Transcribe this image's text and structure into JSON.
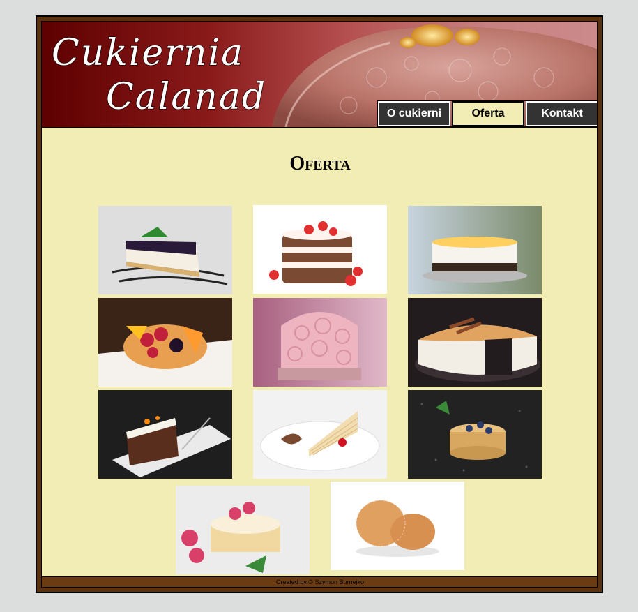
{
  "brand": {
    "line1": "Cukiernia",
    "line2": "Calanad"
  },
  "nav": [
    {
      "label": "O cukierni",
      "active": false
    },
    {
      "label": "Oferta",
      "active": true
    },
    {
      "label": "Kontakt",
      "active": false
    }
  ],
  "page_title": "Oferta",
  "gallery": [
    "blueberry-cheesecake-slice-photo",
    "strawberry-layer-cake-photo",
    "fruit-topped-cheesecake-photo",
    "fruit-tart-photo",
    "pink-rose-cake-photo",
    "meringue-cheesecake-photo",
    "carrot-cake-slice-photo",
    "crepe-cake-slice-photo",
    "pancake-stack-blueberry-photo",
    "raspberry-pancakes-photo",
    "sugar-donuts-photo"
  ],
  "footer": {
    "text": "Created by © Szymon Burnejko"
  },
  "colors": {
    "background": "#dcdedd",
    "content": "#f2edb5",
    "border": "#5a3210",
    "header": "#8a1a1a",
    "nav": "#333333"
  }
}
